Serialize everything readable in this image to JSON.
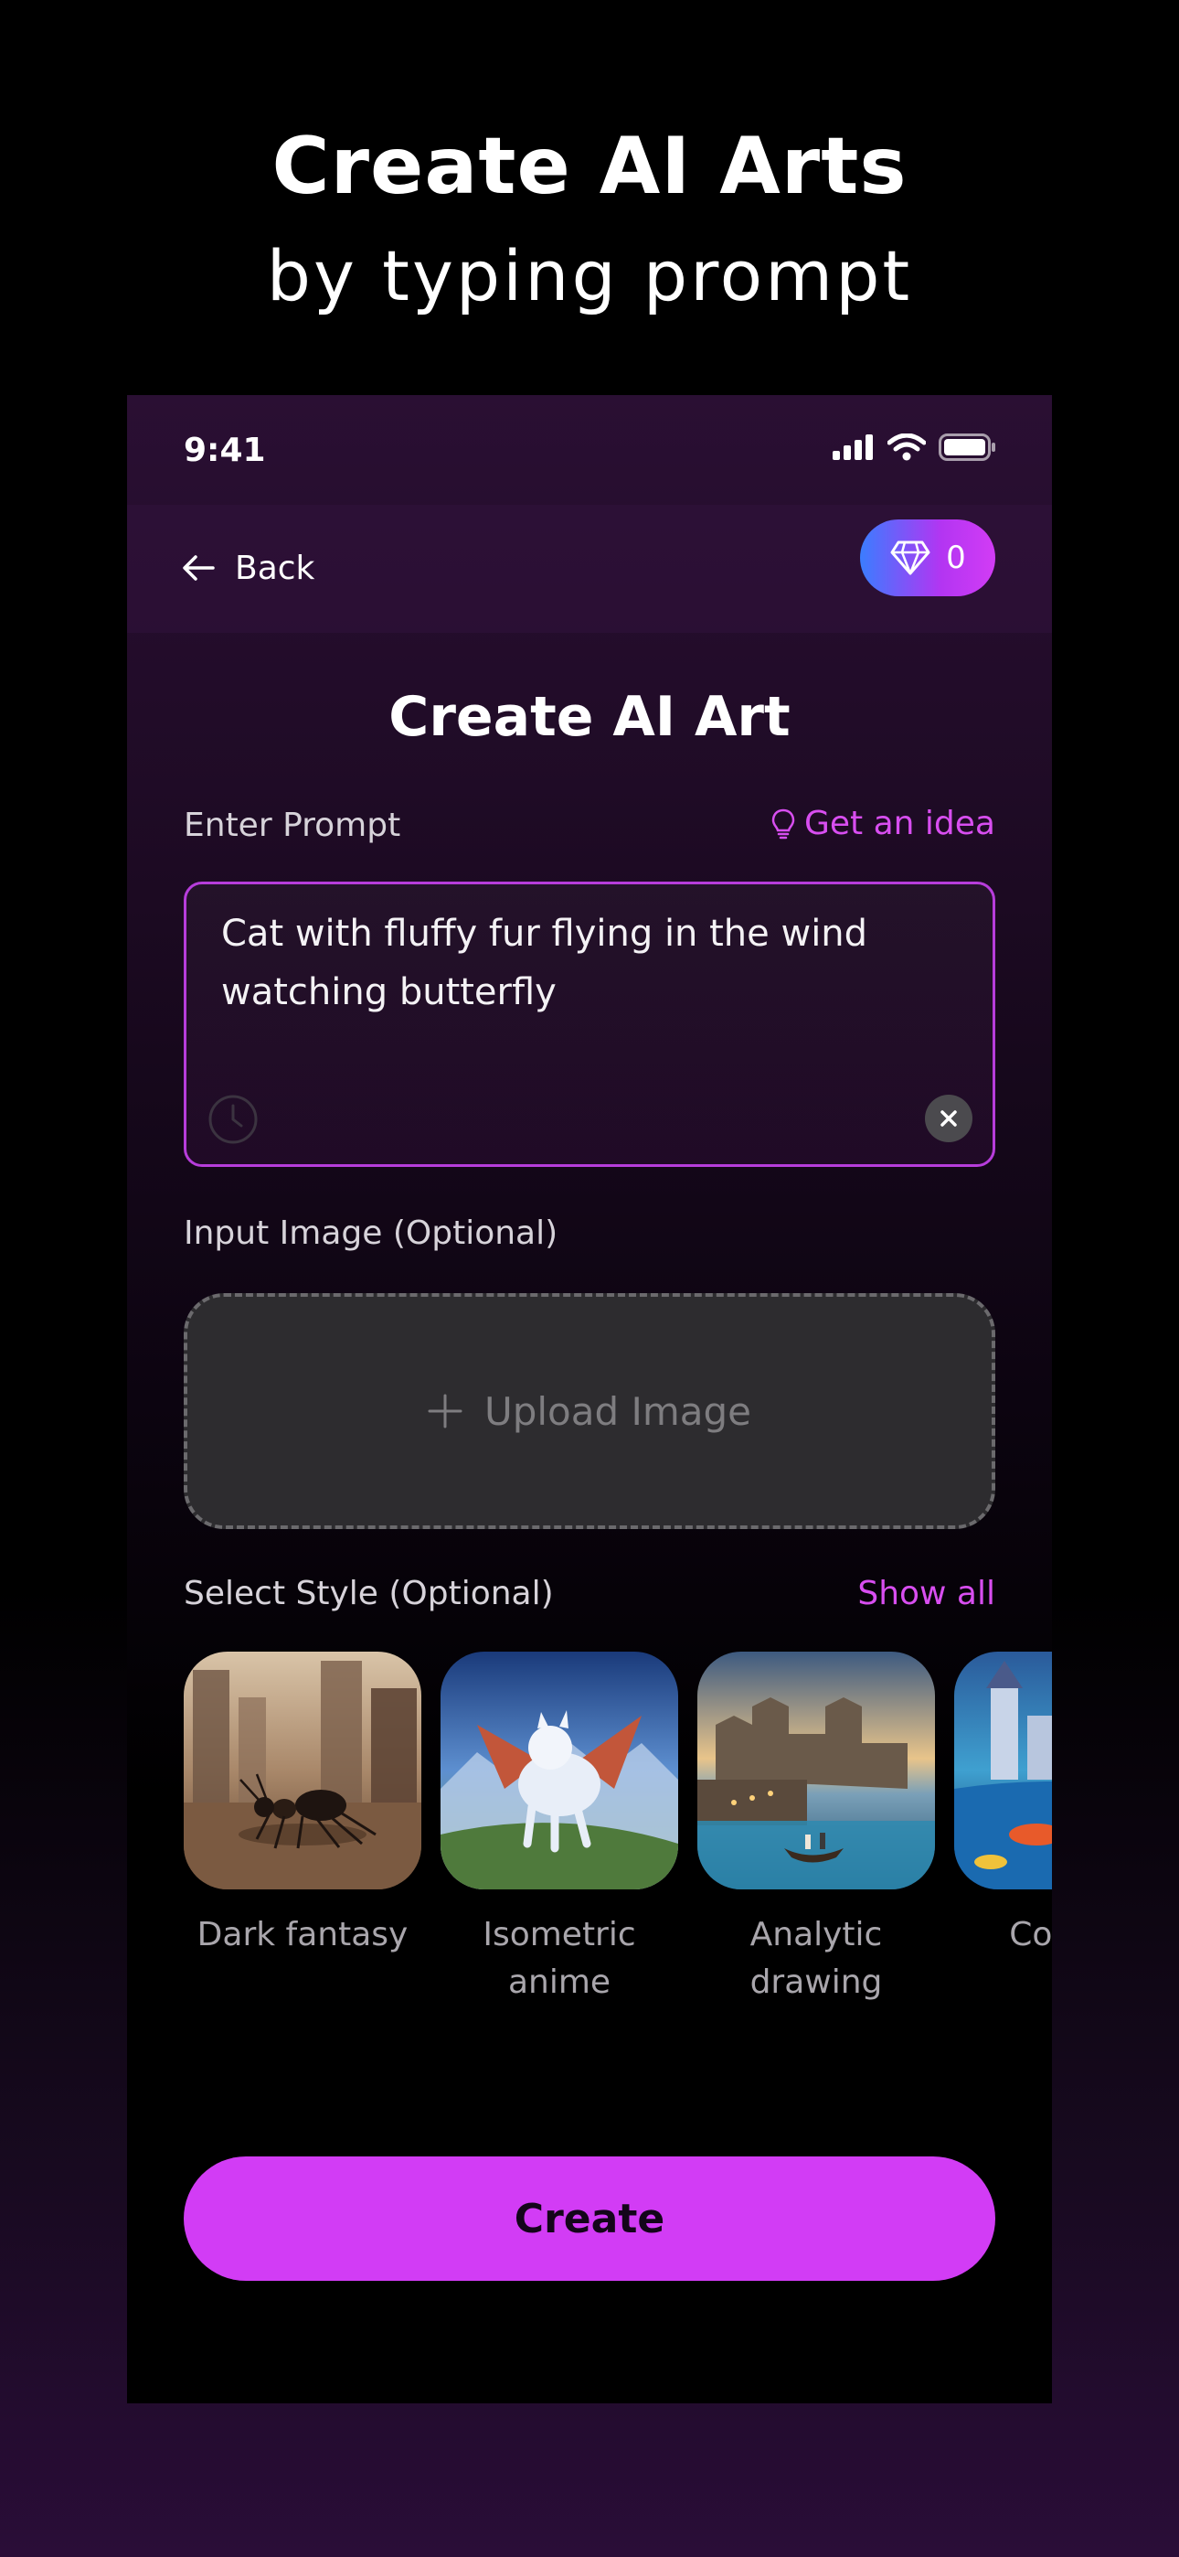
{
  "headline": {
    "title": "Create AI Arts",
    "subtitle": "by typing prompt"
  },
  "status_bar": {
    "time": "9:41",
    "icons": [
      "signal-icon",
      "wifi-icon",
      "battery-icon"
    ]
  },
  "nav": {
    "back_label": "Back",
    "gem_count": "0",
    "gem_icon": "diamond-icon"
  },
  "screen": {
    "title": "Create AI Art"
  },
  "prompt": {
    "label": "Enter Prompt",
    "idea_link": "Get an idea",
    "value": "Cat with fluffy fur flying in the wind watching butterfly"
  },
  "input_image": {
    "label": "Input Image (Optional)",
    "upload_label": "Upload Image"
  },
  "styles": {
    "label": "Select Style (Optional)",
    "show_all": "Show all",
    "items": [
      {
        "name_line1": "Dark fantasy",
        "name_line2": ""
      },
      {
        "name_line1": "Isometric",
        "name_line2": "anime"
      },
      {
        "name_line1": "Analytic",
        "name_line2": "drawing"
      },
      {
        "name_line1": "Colorful",
        "name_line2": ""
      }
    ]
  },
  "actions": {
    "create_label": "Create"
  },
  "colors": {
    "accent": "#d23cf5",
    "link": "#d84ef0",
    "gem_gradient_start": "#3b7dff",
    "prompt_border": "#b73ddb"
  }
}
